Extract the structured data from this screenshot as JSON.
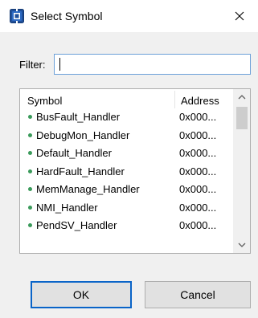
{
  "window": {
    "title": "Select Symbol",
    "icon": "app-chip-icon",
    "close_icon": "close-icon"
  },
  "filter": {
    "label": "Filter:",
    "value": ""
  },
  "table": {
    "columns": [
      "Symbol",
      "Address"
    ],
    "rows": [
      {
        "symbol": "BusFault_Handler",
        "address": "0x000..."
      },
      {
        "symbol": "DebugMon_Handler",
        "address": "0x000..."
      },
      {
        "symbol": "Default_Handler",
        "address": "0x000..."
      },
      {
        "symbol": "HardFault_Handler",
        "address": "0x000..."
      },
      {
        "symbol": "MemManage_Handler",
        "address": "0x000..."
      },
      {
        "symbol": "NMI_Handler",
        "address": "0x000..."
      },
      {
        "symbol": "PendSV_Handler",
        "address": "0x000..."
      }
    ],
    "bullet_color": "#3a9a5a"
  },
  "buttons": {
    "ok": "OK",
    "cancel": "Cancel"
  }
}
